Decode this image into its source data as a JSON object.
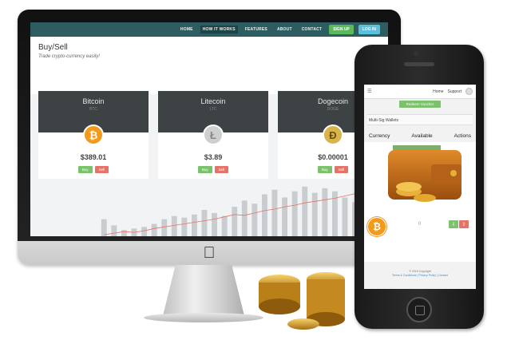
{
  "desktop": {
    "nav": {
      "items": [
        "HOME",
        "HOW IT WORKS",
        "FEATURES",
        "ABOUT",
        "CONTACT"
      ],
      "active_index": 1,
      "signup": "SIGN UP",
      "login": "LOG IN"
    },
    "page": {
      "title": "Buy/Sell",
      "subtitle": "Trade crypto-currency easily!"
    },
    "cards": [
      {
        "name": "Bitcoin",
        "ticker": "BTC",
        "price": "$389.01",
        "buy": "Buy",
        "sell": "Sell",
        "icon": "bitcoin-icon",
        "color": "#f39a1d"
      },
      {
        "name": "Litecoin",
        "ticker": "LTC",
        "price": "$3.89",
        "buy": "Buy",
        "sell": "Sell",
        "icon": "litecoin-icon",
        "color": "#cfcfcf"
      },
      {
        "name": "Dogecoin",
        "ticker": "DOGE",
        "price": "$0.00001",
        "buy": "Buy",
        "sell": "Sell",
        "icon": "dogecoin-icon",
        "color": "#d9b44a"
      }
    ],
    "colors": {
      "navbar": "#2e5d61",
      "buy": "#7cc16b",
      "sell": "#e57368",
      "line": "#e57368",
      "bars": "#c9cdd0"
    }
  },
  "chart_data": {
    "type": "bar",
    "bars": [
      22,
      14,
      8,
      10,
      12,
      16,
      22,
      26,
      24,
      28,
      34,
      30,
      26,
      38,
      46,
      42,
      54,
      60,
      50,
      58,
      64,
      56,
      62,
      58,
      50,
      44,
      40,
      36
    ],
    "line": [
      2,
      4,
      6,
      5,
      7,
      10,
      12,
      14,
      16,
      18,
      20,
      22,
      25,
      28,
      27,
      30,
      33,
      35,
      38,
      40,
      43,
      45,
      47,
      49,
      52,
      55,
      60,
      40
    ],
    "ylim": [
      0,
      70
    ],
    "grid": false
  },
  "phone": {
    "nav": {
      "links": [
        "Home",
        "Support"
      ]
    },
    "redeem": "Redeem Voucher",
    "section": "Multi-Sig Wallets",
    "columns": [
      "Currency",
      "Available",
      "Actions"
    ],
    "balance": "0",
    "footer_line1": "© 2015 Copyright",
    "footer_links": "Terms & Conditions | Privacy Policy | Contact"
  }
}
